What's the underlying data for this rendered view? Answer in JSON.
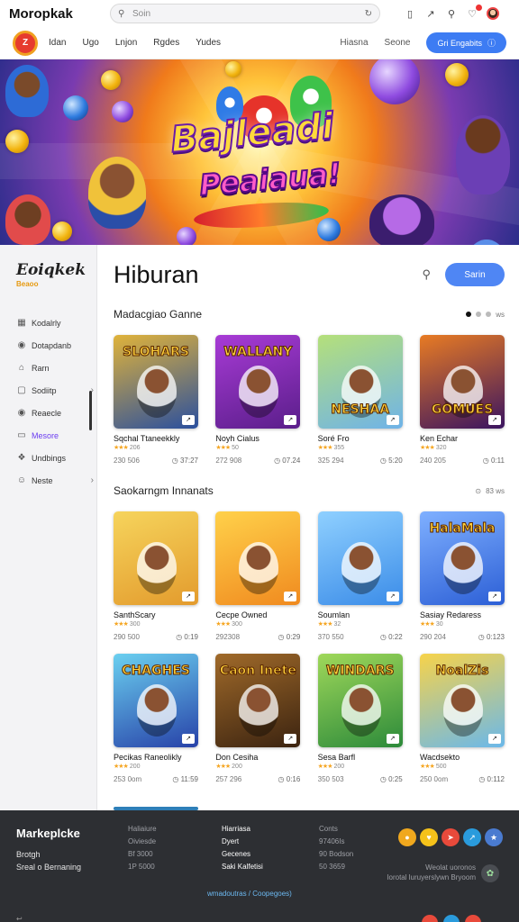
{
  "topbar": {
    "app_title": "Moropkak",
    "search_placeholder": "Soin",
    "icons": [
      "bookmark-icon",
      "share-icon",
      "search-icon",
      "bell-icon",
      "avatar"
    ]
  },
  "navbar": {
    "logo_text": "Z",
    "links": [
      "Idan",
      "Ugo",
      "Lnjon",
      "Rgdes",
      "Yudes"
    ],
    "right_links": [
      "Hiasna",
      "Seone"
    ],
    "cta_label": "Gri Engabits",
    "cta_icon": "info-icon"
  },
  "hero": {
    "title": "Bajleadi",
    "subtitle": "Peaiaua!"
  },
  "sidebar": {
    "logo": "Eoiqkek",
    "logo_sub": "Beaoo",
    "items": [
      {
        "label": "Kodalrly",
        "icon": "calendar-icon",
        "active": false,
        "chevron": false
      },
      {
        "label": "Dotapdanb",
        "icon": "eye-icon",
        "active": false,
        "chevron": false
      },
      {
        "label": "Rarn",
        "icon": "link-icon",
        "active": false,
        "chevron": false
      },
      {
        "label": "Sodiitp",
        "icon": "tag-icon",
        "active": false,
        "chevron": true
      },
      {
        "label": "Reaecle",
        "icon": "eye-icon",
        "active": false,
        "chevron": false
      },
      {
        "label": "Mesore",
        "icon": "folder-icon",
        "active": true,
        "chevron": false
      },
      {
        "label": "Undbings",
        "icon": "gift-icon",
        "active": false,
        "chevron": false
      },
      {
        "label": "Neste",
        "icon": "smile-icon",
        "active": false,
        "chevron": true
      }
    ]
  },
  "main": {
    "title": "Hiburan",
    "button_label": "Sarin",
    "sections": [
      {
        "title": "Madacgiao Ganne",
        "ctrl_text": "ws",
        "cards": [
          {
            "thumb_text": "SLOHARS",
            "name": "Sqchal Ttaneekkly",
            "rating": "206",
            "meta_left": "230 506",
            "meta_right": "37:27",
            "colors": [
              "#2a4f9e",
              "#e0b33a"
            ]
          },
          {
            "thumb_text": "WALLANY",
            "name": "Noyh Cialus",
            "rating": "50",
            "meta_left": "272 908",
            "meta_right": "07.24",
            "colors": [
              "#5a1e8a",
              "#a83bd6"
            ]
          },
          {
            "thumb_text": "NESHAA",
            "name": "Soré Fro",
            "rating": "355",
            "meta_left": "325 294",
            "meta_right": "5:20",
            "colors": [
              "#6fb3e8",
              "#b5e07a"
            ]
          },
          {
            "thumb_text": "GOMUES",
            "name": "Ken Echar",
            "rating": "320",
            "meta_left": "240 205",
            "meta_right": "0:11",
            "colors": [
              "#3a1460",
              "#e87b23"
            ]
          }
        ]
      },
      {
        "title": "Saokarngm Innanats",
        "ctrl_text": "83  ws",
        "cards": [
          {
            "thumb_text": "",
            "name": "SanthScary",
            "rating": "300",
            "meta_left": "290 500",
            "meta_right": "0:19",
            "colors": [
              "#e39b2d",
              "#f6d45c"
            ]
          },
          {
            "thumb_text": "",
            "name": "Cecpe Owned",
            "rating": "300",
            "meta_left": "292308",
            "meta_right": "0:29",
            "colors": [
              "#f08a1f",
              "#ffd14a"
            ]
          },
          {
            "thumb_text": "",
            "name": "Soumlan",
            "rating": "32",
            "meta_left": "370 550",
            "meta_right": "0:22",
            "colors": [
              "#3b8ce8",
              "#8fd0ff"
            ]
          },
          {
            "thumb_text": "HalaMala",
            "name": "Sasiay Redaress",
            "rating": "30",
            "meta_left": "290 204",
            "meta_right": "0:123",
            "colors": [
              "#2c5fd6",
              "#7fb0ff"
            ]
          }
        ]
      },
      {
        "title": "",
        "ctrl_text": "",
        "cards": [
          {
            "thumb_text": "CHAGHES",
            "name": "Pecikas Raneolikly",
            "rating": "200",
            "meta_left": "253 0om",
            "meta_right": "11:59",
            "colors": [
              "#2741a8",
              "#6bd0f0"
            ]
          },
          {
            "thumb_text": "Caon Inete",
            "name": "Don Cesiha",
            "rating": "200",
            "meta_left": "257 296",
            "meta_right": "0:16",
            "colors": [
              "#3b2310",
              "#a06a2a"
            ]
          },
          {
            "thumb_text": "WINDARS",
            "name": "Sesa Barfl",
            "rating": "200",
            "meta_left": "350 503",
            "meta_right": "0:25",
            "colors": [
              "#2c8a3a",
              "#9fd85a"
            ]
          },
          {
            "thumb_text": "NoalZis",
            "name": "Wacdsekto",
            "rating": "500",
            "meta_left": "250 0om",
            "meta_right": "0:112",
            "colors": [
              "#6ab8ea",
              "#f7d34a"
            ]
          }
        ]
      }
    ]
  },
  "footer": {
    "brand": "Markeplcke",
    "line1": "Brotgh",
    "line2": "Sreal o Bernaning",
    "col1": [
      "Haliaiure",
      "Oiviesde",
      "Bf 3000",
      "1P 5000"
    ],
    "col2": [
      "Hiarriasa",
      "Dyert",
      "Gecenes",
      "Saki Kalfetisi"
    ],
    "col3": [
      "Conts",
      "97406Is",
      "90 Bodson",
      "50 3659"
    ],
    "note_line1": "Weolat uoronos",
    "note_line2": "lorotal luruyerslywn Bryoom",
    "link": "wmadoutras / Coopegoes)",
    "bottom_text": "↩",
    "social_colors": [
      "#f0a81e",
      "#f5c21a",
      "#e84a3b",
      "#2a9bdc",
      "#4a7bd0"
    ],
    "bottom_dot_colors": [
      "#e84a3b",
      "#2a9bdc",
      "#e84a3b"
    ]
  }
}
